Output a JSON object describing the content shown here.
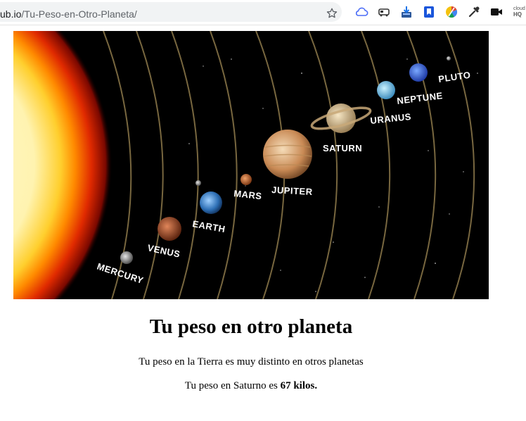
{
  "browser": {
    "url_host": "ub.io",
    "url_path": "/Tu-Peso-en-Otro-Planeta/",
    "extension_icons": [
      "cloud-icon",
      "car-icon",
      "download-icon",
      "bookmark-icon",
      "color-wheel-icon",
      "eyedropper-icon",
      "video-camera-icon",
      "cloud-hq-icon"
    ],
    "cloud_hq_label_top": "cloud",
    "cloud_hq_label_bottom": "HQ"
  },
  "hero": {
    "planet_labels": {
      "mercury": "MERCURY",
      "venus": "VENUS",
      "earth": "EARTH",
      "mars": "MARS",
      "jupiter": "JUPITER",
      "saturn": "SATURN",
      "uranus": "URANUS",
      "neptune": "NEPTUNE",
      "pluto": "PLUTO"
    }
  },
  "page": {
    "title": "Tu peso en otro planeta",
    "subtitle": "Tu peso en la Tierra es muy distinto en otros planetas",
    "weight_prefix": "Tu peso en Saturno es ",
    "weight_value": "67 kilos."
  }
}
